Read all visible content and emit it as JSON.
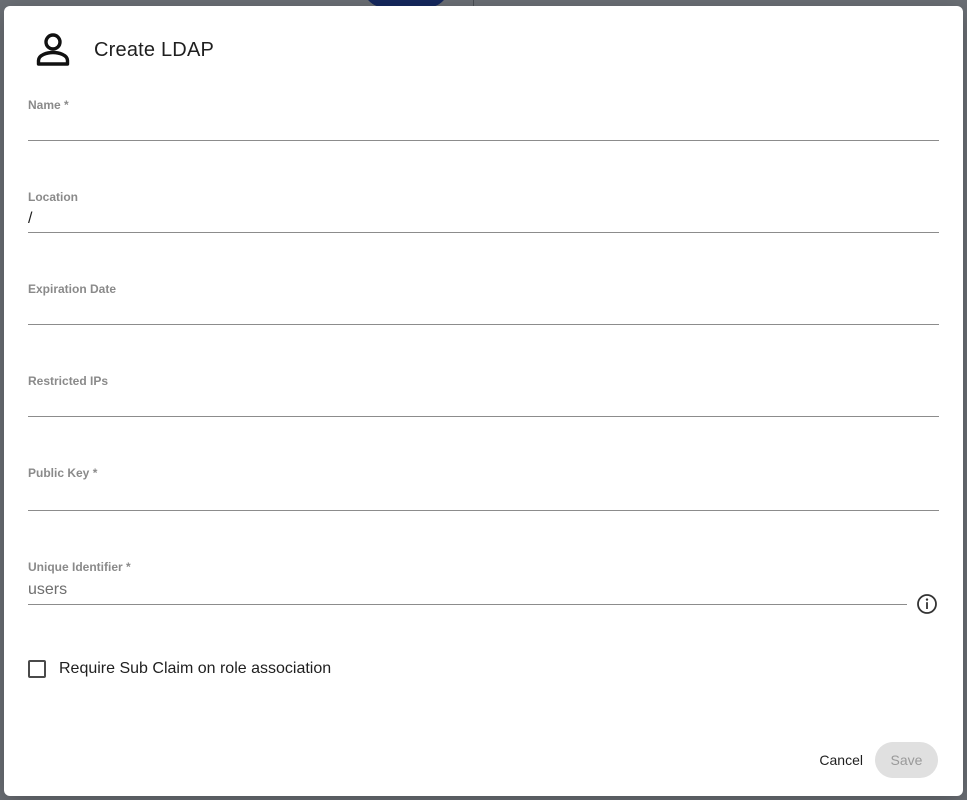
{
  "dialog": {
    "title": "Create LDAP",
    "icon": "person-icon"
  },
  "fields": {
    "name": {
      "label": "Name *",
      "value": "",
      "placeholder": ""
    },
    "location": {
      "label": "Location",
      "value": "/",
      "placeholder": ""
    },
    "expiration_date": {
      "label": "Expiration Date",
      "value": "",
      "placeholder": ""
    },
    "restricted_ips": {
      "label": "Restricted IPs",
      "value": "",
      "placeholder": ""
    },
    "public_key": {
      "label": "Public Key *",
      "value": "",
      "placeholder": ""
    },
    "unique_identifier": {
      "label": "Unique Identifier *",
      "value": "",
      "placeholder": "users"
    }
  },
  "checkbox": {
    "label": "Require Sub Claim on role association",
    "checked": false
  },
  "footer": {
    "cancel_label": "Cancel",
    "save_label": "Save"
  },
  "colors": {
    "backdrop": "#6b6f75",
    "save_disabled_bg": "#e0e0e0",
    "save_disabled_text": "#9a9a9a"
  }
}
